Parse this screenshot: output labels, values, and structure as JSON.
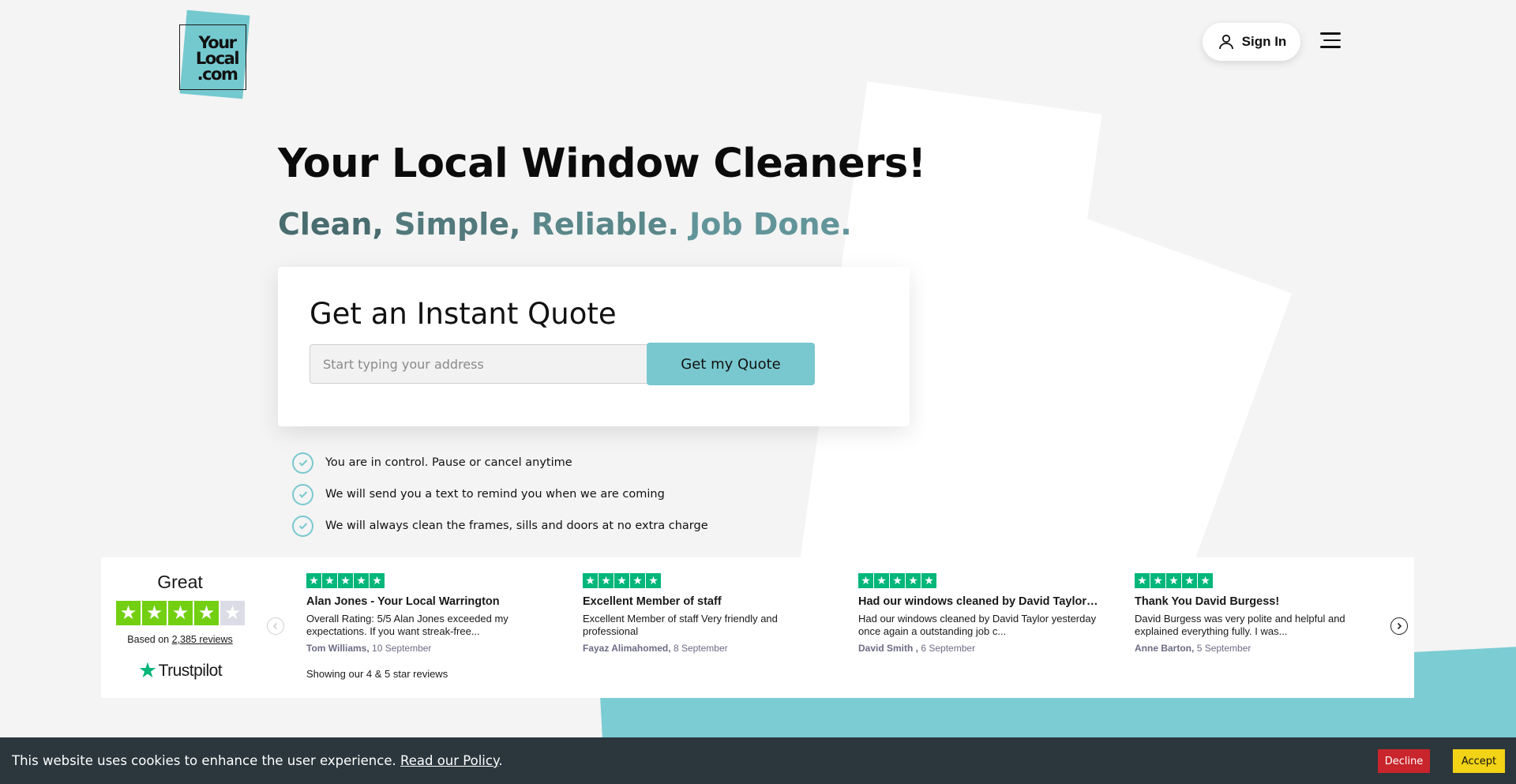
{
  "logo": {
    "line1": "Your",
    "line2": "Local",
    "line3": ".com"
  },
  "header": {
    "sign_in_label": "Sign In"
  },
  "hero": {
    "title": "Your Local Window Cleaners!",
    "subtitle_words": [
      "Clean,",
      "Simple,",
      "Reliable.",
      "Job Done."
    ]
  },
  "quote": {
    "heading": "Get an Instant Quote",
    "input_placeholder": "Start typing your address",
    "button_label": "Get my Quote"
  },
  "benefits": [
    "You are in control. Pause or cancel anytime",
    "We will send you a text to remind you when we are coming",
    "We will always clean the frames, sills and doors at no extra charge"
  ],
  "trustpilot": {
    "rating_word": "Great",
    "stars_filled": 4,
    "stars_total": 5,
    "based_on_prefix": "Based on",
    "review_count": "2,385 reviews",
    "brand": "Trustpilot",
    "showing_text": "Showing our 4 & 5 star reviews"
  },
  "reviews": [
    {
      "stars": 5,
      "title": "Alan Jones - Your Local Warrington",
      "body": "Overall Rating: 5/5 Alan Jones exceeded my expectations. If you want streak-free...",
      "author": "Tom Williams,",
      "date": "10 September"
    },
    {
      "stars": 5,
      "title": "Excellent Member of staff",
      "body": "Excellent Member of staff Very friendly and professional",
      "author": "Fayaz Alimahomed,",
      "date": "8 September"
    },
    {
      "stars": 5,
      "title": "Had our windows cleaned by David Taylor…",
      "body": "Had our windows cleaned by David Taylor yesterday once again a outstanding job c...",
      "author": "David Smith ,",
      "date": "6 September"
    },
    {
      "stars": 5,
      "title": "Thank You David Burgess!",
      "body": "David Burgess was very polite and helpful and explained everything fully. I was...",
      "author": "Anne Barton,",
      "date": "5 September"
    }
  ],
  "cookie": {
    "text": "This website uses cookies to enhance the user experience.",
    "link": "Read our Policy",
    "suffix": ".",
    "decline_label": "Decline",
    "accept_label": "Accept"
  },
  "colors": {
    "brand_teal": "#79c8cf",
    "trustpilot_green": "#00b67a",
    "summary_star_green": "#73cf11",
    "cookie_bar": "#2b373d",
    "decline_red": "#c9252c",
    "accept_yellow": "#f2d315"
  },
  "icons": [
    "user-icon",
    "hamburger-menu-icon",
    "check-circle-icon",
    "star-icon",
    "chevron-left-icon",
    "chevron-right-icon",
    "trustpilot-star-icon"
  ]
}
